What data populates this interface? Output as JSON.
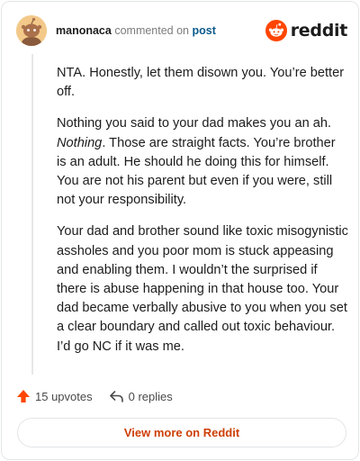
{
  "header": {
    "username": "manonaca",
    "verb": "commented on",
    "post_link": "post",
    "brand": "reddit",
    "avatar_icon": "snoo-avatar-icon",
    "logo_icon": "reddit-logo-icon"
  },
  "comment": {
    "p1": "NTA. Honestly, let them disown you. You’re better off.",
    "p2_em": "Nothing",
    "p2_lead": "Nothing you said to your dad makes you an ah. ",
    "p2_rest": ". Those are straight facts. You’re brother is an adult. He should he doing this for himself. You are not his parent but even if you were, still not your responsibility.",
    "p3": "Your dad and brother sound like toxic misogynistic assholes and you poor mom is stuck appeasing and enabling them. I wouldn’t the surprised if there is abuse happening in that house too. Your dad became verbally abusive to you when you set a clear boundary and called out toxic behaviour. I’d go NC if it was me."
  },
  "footer": {
    "upvotes": "15 upvotes",
    "replies": "0 replies",
    "upvote_icon": "upvote-arrow-icon",
    "reply_icon": "reply-arrow-icon",
    "upvote_color": "#ff4500"
  },
  "cta": {
    "label": "View more on Reddit",
    "color": "#cd3f06"
  },
  "colors": {
    "brand": "#ff4500",
    "link": "#0a5a8c"
  }
}
